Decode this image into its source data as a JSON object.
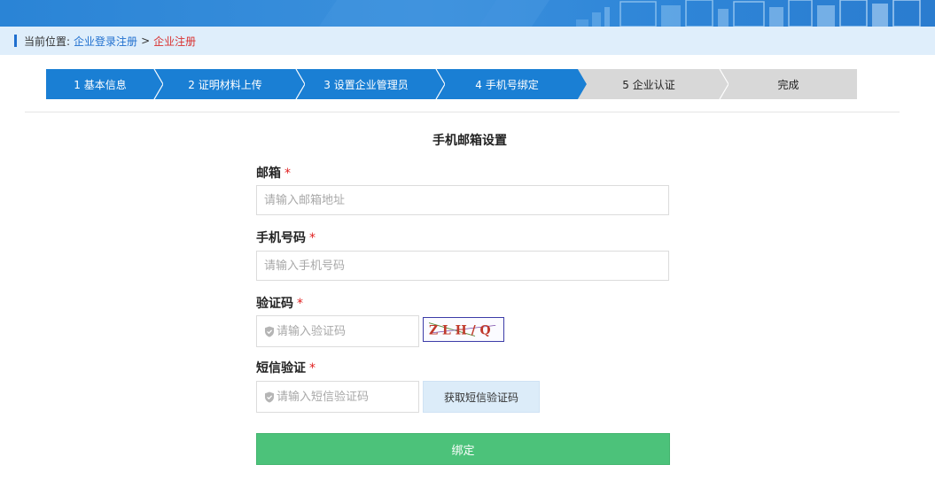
{
  "breadcrumb": {
    "prefix": "当前位置:",
    "link": "企业登录注册",
    "separator": ">",
    "current": "企业注册"
  },
  "steps": [
    {
      "label": "1 基本信息",
      "state": "done"
    },
    {
      "label": "2 证明材料上传",
      "state": "done"
    },
    {
      "label": "3 设置企业管理员",
      "state": "done"
    },
    {
      "label": "4 手机号绑定",
      "state": "done"
    },
    {
      "label": "5 企业认证",
      "state": "todo"
    },
    {
      "label": "完成",
      "state": "todo"
    }
  ],
  "form": {
    "title": "手机邮箱设置",
    "required_mark": "*",
    "email_label": "邮箱",
    "email_placeholder": "请输入邮箱地址",
    "phone_label": "手机号码",
    "phone_placeholder": "请输入手机号码",
    "captcha_label": "验证码",
    "captcha_placeholder": "请输入验证码",
    "captcha_text": "Z L H / Q",
    "sms_label": "短信验证",
    "sms_placeholder": "请输入短信验证码",
    "sms_button": "获取短信验证码",
    "submit_button": "绑定"
  },
  "colors": {
    "step_active": "#1a7fd4",
    "step_inactive": "#d8d8d8",
    "submit": "#4cc27a",
    "required": "#e02020",
    "link": "#1f6fcf",
    "breadcrumb_current": "#d9302f"
  },
  "icons": {
    "shield": "shield-icon"
  }
}
